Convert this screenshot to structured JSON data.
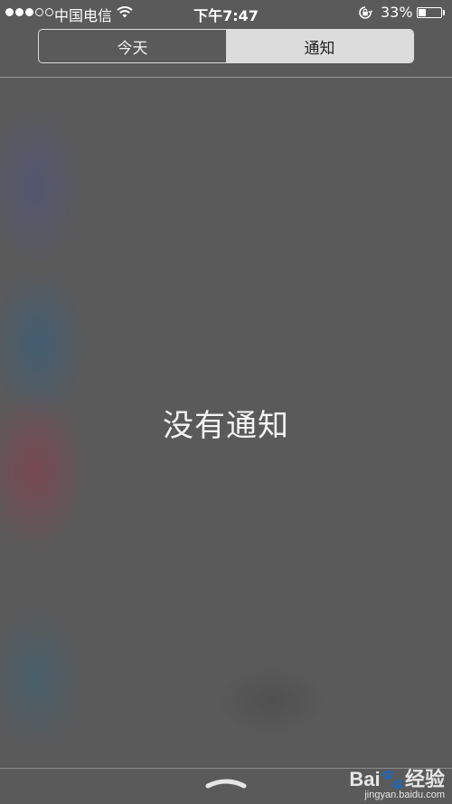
{
  "status_bar": {
    "carrier": "中国电信",
    "time": "下午7:47",
    "battery_percent_label": "33%",
    "battery_level": 0.33,
    "signal_bars_filled": 3,
    "signal_bars_total": 5,
    "icons": [
      "signal-dots-icon",
      "wifi-icon",
      "rotation-lock-icon",
      "battery-icon"
    ]
  },
  "tabs": [
    {
      "label": "今天",
      "selected": false
    },
    {
      "label": "通知",
      "selected": true
    }
  ],
  "main": {
    "empty_message": "没有通知"
  },
  "bottom": {
    "grabber_icon": "grabber-chevron-icon"
  },
  "watermark": {
    "logo": "Bai🐾经验",
    "url": "jingyan.baidu.com"
  },
  "colors": {
    "background": "#5a5a5a",
    "segment_selected_bg": "#dcdcdc",
    "segment_border": "#dcdcdc",
    "text": "#ffffff"
  }
}
